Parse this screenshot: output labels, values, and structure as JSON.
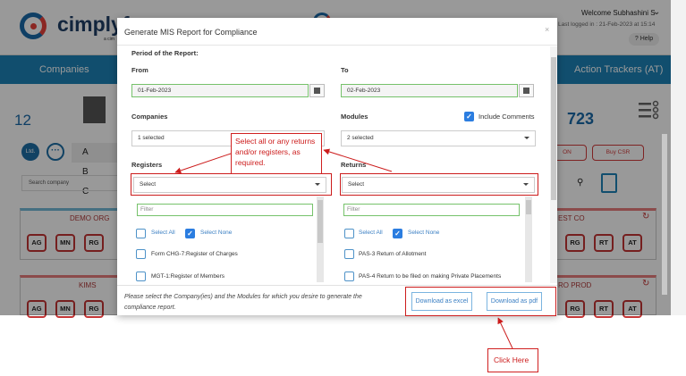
{
  "app": {
    "logo_text": "cimplyf",
    "logo_subtext": "a cim",
    "welcome": "Welcome Subhashini  S",
    "last_logged": "Last logged in : 21-Feb-2023 at 15:14",
    "help": "Help",
    "nav_left": "Companies",
    "nav_right": "Action Trackers (AT)",
    "stat_left": "12",
    "stat_right": "723",
    "ltd_badge": "Ltd.",
    "more_badge": "···",
    "alpha_filter": "A B C",
    "search_placeholder": "Search company",
    "btn_right_1": "ON",
    "btn_right_2": "Buy CSR",
    "cards": [
      {
        "name": "DEMO ORG",
        "chips": [
          "AG",
          "MN",
          "RG"
        ]
      },
      {
        "name": "KIMS",
        "chips": [
          "AG",
          "MN",
          "RG"
        ]
      },
      {
        "name": "EST CO",
        "chips": [
          "RG",
          "RT",
          "AT"
        ]
      },
      {
        "name": "RO PROD",
        "chips": [
          "RG",
          "RT",
          "AT"
        ]
      }
    ]
  },
  "modal": {
    "title": "Generate MIS Report for Compliance",
    "close": "×",
    "period_label": "Period of the Report:",
    "from_label": "From",
    "to_label": "To",
    "from_value": "01-Feb-2023",
    "to_value": "02-Feb-2023",
    "companies_label": "Companies",
    "modules_label": "Modules",
    "include_comments_label": "Include Comments",
    "include_comments_checked": true,
    "companies_value": "1 selected",
    "modules_value": "2 selected",
    "registers_label": "Registers",
    "returns_label": "Returns",
    "registers_select": "Select",
    "returns_select": "Select",
    "filter_placeholder": "Filter",
    "select_all": "Select All",
    "select_none": "Select None",
    "registers_items": [
      "Form CHG-7:Register of Charges",
      "MGT-1:Register of Members"
    ],
    "returns_items": [
      "PAS-3 Return of Allotment",
      "PAS-4 Return to be filed on making Private Placements"
    ],
    "footer_note": "Please select the Company(ies) and the Modules for which you desire to generate the compliance report.",
    "download_excel": "Download as excel",
    "download_pdf": "Download as pdf"
  },
  "annotations": {
    "callout_text": "Select all or any returns and/or registers, as required.",
    "click_here": "Click Here",
    "accent_color": "#cc1c1c"
  }
}
